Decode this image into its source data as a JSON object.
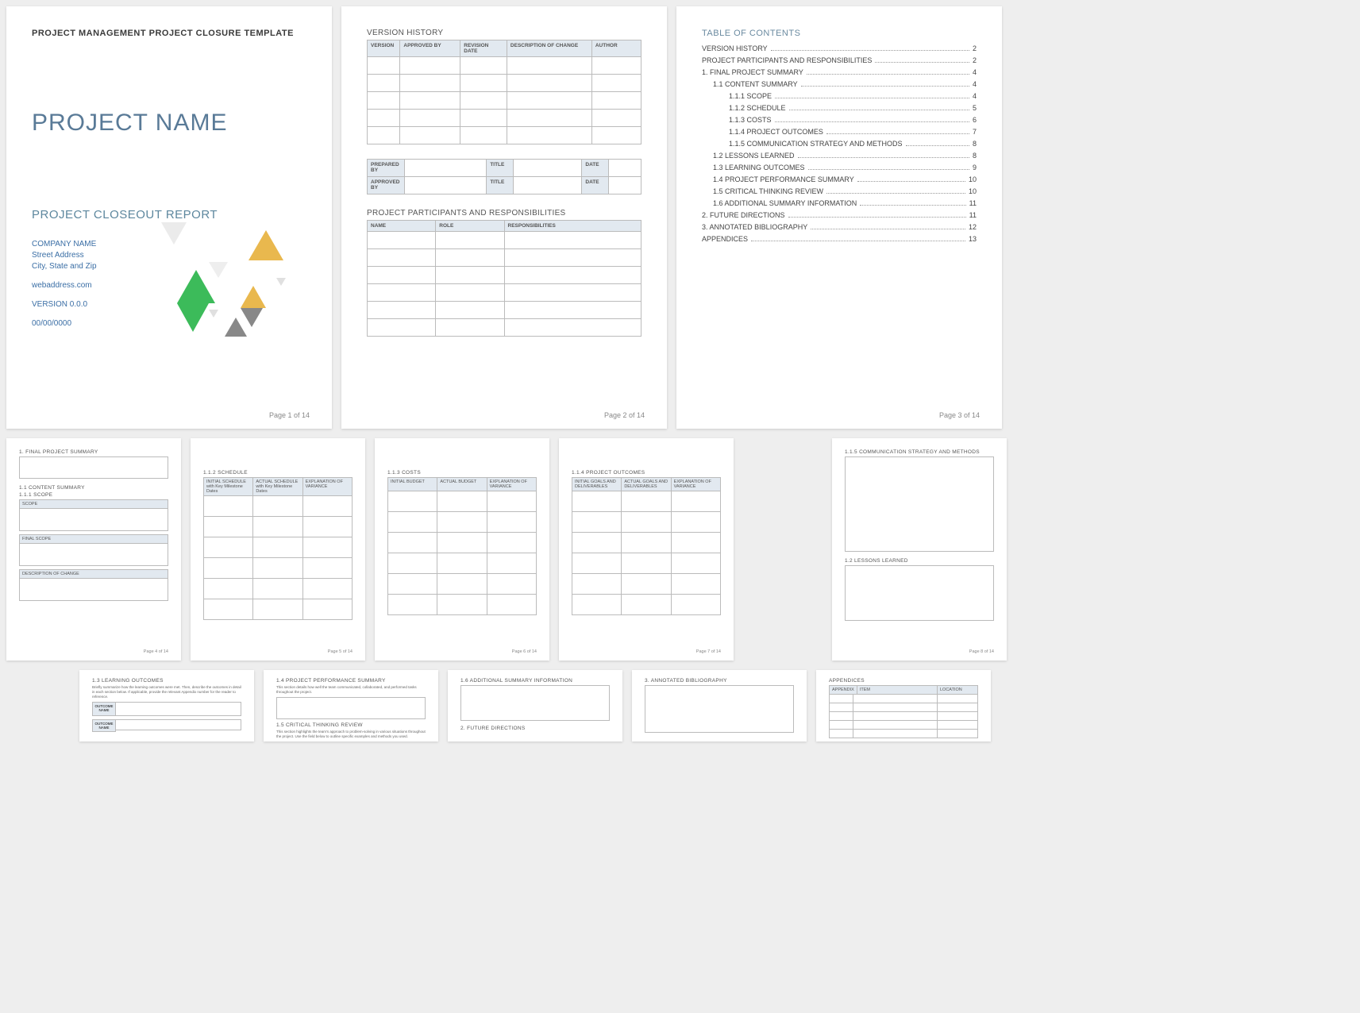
{
  "page1": {
    "header": "PROJECT MANAGEMENT PROJECT CLOSURE TEMPLATE",
    "title": "PROJECT NAME",
    "subtitle": "PROJECT CLOSEOUT REPORT",
    "company": "COMPANY NAME",
    "street": "Street Address",
    "city": "City, State and Zip",
    "web": "webaddress.com",
    "version": "VERSION 0.0.0",
    "date": "00/00/0000",
    "footer": "Page 1 of 14"
  },
  "page2": {
    "sec1": "VERSION HISTORY",
    "vh_headers": [
      "VERSION",
      "APPROVED BY",
      "REVISION DATE",
      "DESCRIPTION OF CHANGE",
      "AUTHOR"
    ],
    "mid": {
      "prepared": "PREPARED BY",
      "approved": "APPROVED BY",
      "title": "TITLE",
      "date": "DATE"
    },
    "sec2": "PROJECT PARTICIPANTS AND RESPONSIBILITIES",
    "pp_headers": [
      "NAME",
      "ROLE",
      "RESPONSIBILITIES"
    ],
    "footer": "Page 2 of 14"
  },
  "page3": {
    "title": "TABLE OF CONTENTS",
    "items": [
      {
        "label": "VERSION HISTORY",
        "page": "2",
        "indent": 0
      },
      {
        "label": "PROJECT PARTICIPANTS AND RESPONSIBILITIES",
        "page": "2",
        "indent": 0
      },
      {
        "prefix": "1.",
        "label": "FINAL PROJECT SUMMARY",
        "page": "4",
        "indent": 0
      },
      {
        "prefix": "1.1",
        "label": "CONTENT SUMMARY",
        "page": "4",
        "indent": 1
      },
      {
        "prefix": "1.1.1",
        "label": "SCOPE",
        "page": "4",
        "indent": 2
      },
      {
        "prefix": "1.1.2",
        "label": "SCHEDULE",
        "page": "5",
        "indent": 2
      },
      {
        "prefix": "1.1.3",
        "label": "COSTS",
        "page": "6",
        "indent": 2
      },
      {
        "prefix": "1.1.4",
        "label": "PROJECT OUTCOMES",
        "page": "7",
        "indent": 2
      },
      {
        "prefix": "1.1.5",
        "label": "COMMUNICATION STRATEGY AND METHODS",
        "page": "8",
        "indent": 2
      },
      {
        "prefix": "1.2",
        "label": "LESSONS LEARNED",
        "page": "8",
        "indent": 1
      },
      {
        "prefix": "1.3",
        "label": "LEARNING OUTCOMES",
        "page": "9",
        "indent": 1
      },
      {
        "prefix": "1.4",
        "label": "PROJECT PERFORMANCE SUMMARY",
        "page": "10",
        "indent": 1
      },
      {
        "prefix": "1.5",
        "label": "CRITICAL THINKING REVIEW",
        "page": "10",
        "indent": 1
      },
      {
        "prefix": "1.6",
        "label": "ADDITIONAL SUMMARY INFORMATION",
        "page": "11",
        "indent": 1
      },
      {
        "prefix": "2.",
        "label": "FUTURE DIRECTIONS",
        "page": "11",
        "indent": 0
      },
      {
        "prefix": "3.",
        "label": "ANNOTATED BIBLIOGRAPHY",
        "page": "12",
        "indent": 0
      },
      {
        "label": "APPENDICES",
        "page": "13",
        "indent": 0
      }
    ],
    "footer": "Page 3 of 14"
  },
  "page4": {
    "t1": "1.  FINAL PROJECT SUMMARY",
    "t2": "1.1  CONTENT SUMMARY",
    "t3": "1.1.1  SCOPE",
    "scope": "SCOPE",
    "final": "FINAL SCOPE",
    "desc": "DESCRIPTION OF CHANGE",
    "footer": "Page 4 of 14"
  },
  "page5": {
    "t": "1.1.2  SCHEDULE",
    "h": [
      "INITIAL SCHEDULE with Key Milestone Dates",
      "ACTUAL SCHEDULE with Key Milestone Dates",
      "EXPLANATION OF VARIANCE"
    ],
    "footer": "Page 5 of 14"
  },
  "page6": {
    "t": "1.1.3  COSTS",
    "h": [
      "INITIAL BUDGET",
      "ACTUAL BUDGET",
      "EXPLANATION OF VARIANCE"
    ],
    "footer": "Page 6 of 14"
  },
  "page7": {
    "t": "1.1.4  PROJECT OUTCOMES",
    "h": [
      "INITIAL GOALS AND DELIVERABLES",
      "ACTUAL GOALS AND DELIVERABLES",
      "EXPLANATION OF VARIANCE"
    ],
    "footer": "Page 7 of 14"
  },
  "page8": {
    "t1": "1.1.5  COMMUNICATION STRATEGY AND METHODS",
    "t2": "1.2  LESSONS LEARNED",
    "footer": "Page 8 of 14"
  },
  "page9": {
    "t": "1.3  LEARNING OUTCOMES",
    "desc": "Briefly summarize how the learning outcomes were met. Then, describe the outcomes in detail in each section below. If applicable, provide the relevant Appendix number for the reader to reference.",
    "col": "OUTCOME NAME"
  },
  "page10": {
    "t1": "1.4  PROJECT PERFORMANCE SUMMARY",
    "d1": "This section details how well the team communicated, collaborated, and performed tasks throughout the project.",
    "t2": "1.5  CRITICAL THINKING REVIEW",
    "d2": "This section highlights the team's approach to problem-solving in various situations throughout the project. Use the field below to outline specific examples and methods you used."
  },
  "page11": {
    "t1": "1.6  ADDITIONAL SUMMARY INFORMATION",
    "t2": "2.  FUTURE DIRECTIONS"
  },
  "page12": {
    "t": "3.  ANNOTATED BIBLIOGRAPHY"
  },
  "page13": {
    "t": "APPENDICES",
    "h": [
      "APPENDIX",
      "ITEM",
      "LOCATION"
    ]
  }
}
